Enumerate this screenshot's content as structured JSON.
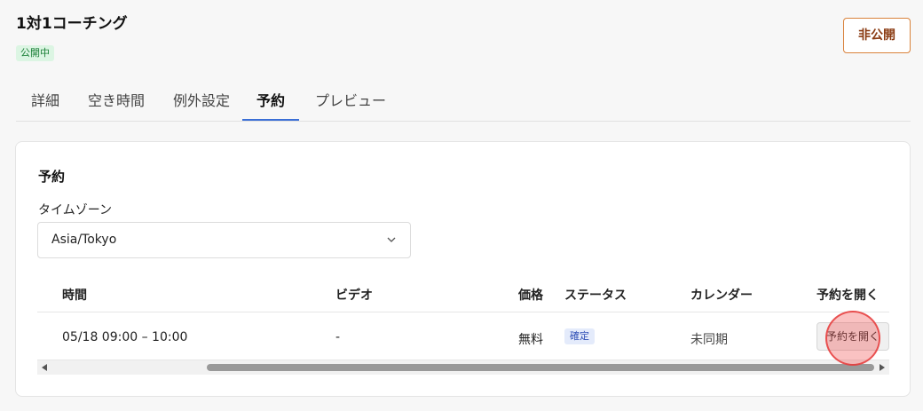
{
  "page": {
    "title": "1対1コーチング",
    "status_badge": "公開中",
    "unpublish_label": "非公開"
  },
  "tabs": [
    {
      "label": "詳細",
      "active": false
    },
    {
      "label": "空き時間",
      "active": false
    },
    {
      "label": "例外設定",
      "active": false
    },
    {
      "label": "予約",
      "active": true
    },
    {
      "label": "プレビュー",
      "active": false
    }
  ],
  "bookings": {
    "title": "予約",
    "timezone_label": "タイムゾーン",
    "timezone_value": "Asia/Tokyo",
    "columns": [
      "時間",
      "ビデオ",
      "価格",
      "ステータス",
      "カレンダー",
      "予約を開く"
    ],
    "rows": [
      {
        "time": "05/18 09:00 – 10:00",
        "video": "-",
        "price": "無料",
        "status": "確定",
        "calendar": "未同期",
        "open_label": "予約を開く"
      }
    ]
  },
  "colors": {
    "accent": "#3b6fd6",
    "published_green": "#1a7f37",
    "unpublish_border": "#d9823b"
  }
}
